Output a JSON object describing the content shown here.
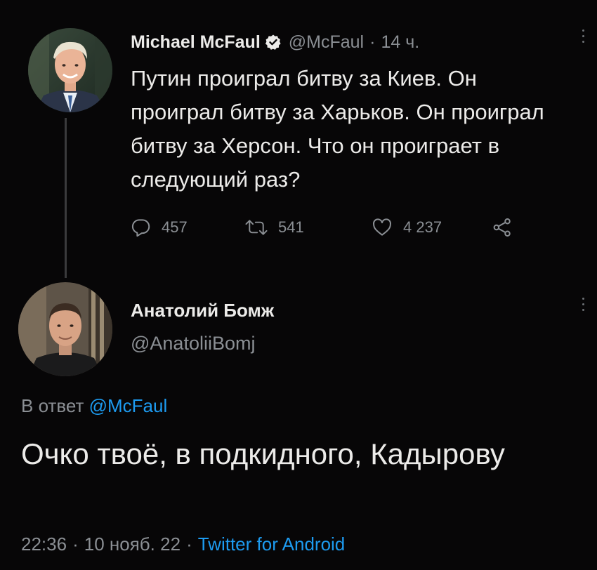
{
  "tweet1": {
    "author_name": "Michael McFaul",
    "handle": "@McFaul",
    "time_ago": "14 ч.",
    "text": "Путин проиграл битву за Киев. Он проиграл битву за Харьков. Он проиграл битву за Херсон. Что он проиграет в следующий раз?",
    "replies": "457",
    "retweets": "541",
    "likes": "4 237"
  },
  "tweet2": {
    "author_name": "Анатолий Бомж",
    "handle": "@AnatoliiBomj",
    "reply_prefix": "В ответ ",
    "reply_to": "@McFaul",
    "text": "Очко твоё, в подкидного, Кадырову",
    "time": "22:36",
    "date": "10 нояб. 22",
    "source": "Twitter for Android"
  },
  "colors": {
    "background": "#070607",
    "text": "#ecebe9",
    "muted": "#8b8f94",
    "link": "#1d9bf0",
    "thread_line": "#3a3a3c"
  },
  "icons": [
    "verified-badge-icon",
    "reply-icon",
    "retweet-icon",
    "like-icon",
    "share-icon",
    "more-icon"
  ]
}
